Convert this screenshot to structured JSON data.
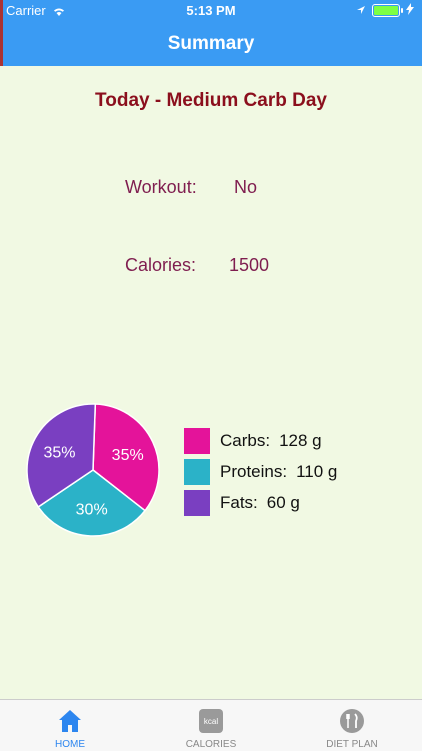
{
  "status_bar": {
    "carrier": "Carrier",
    "time": "5:13 PM"
  },
  "nav": {
    "title": "Summary"
  },
  "day_title": "Today - Medium Carb Day",
  "workout": {
    "label": "Workout:",
    "value": "No"
  },
  "calories": {
    "label": "Calories:",
    "value": "1500"
  },
  "chart_data": {
    "type": "pie",
    "slices": [
      {
        "name": "Carbs",
        "value": 35,
        "label": "35%",
        "color": "#e4139a"
      },
      {
        "name": "Proteins",
        "value": 30,
        "label": "30%",
        "color": "#2bb2c8"
      },
      {
        "name": "Fats",
        "value": 35,
        "label": "35%",
        "color": "#7a3fc1"
      }
    ]
  },
  "legend": [
    {
      "name": "Carbs:",
      "amount": "128 g",
      "color": "#e4139a"
    },
    {
      "name": "Proteins:",
      "amount": "110 g",
      "color": "#2bb2c8"
    },
    {
      "name": "Fats:",
      "amount": "60 g",
      "color": "#7a3fc1"
    }
  ],
  "tabs": [
    {
      "label": "HOME",
      "icon": "home-icon",
      "active": true
    },
    {
      "label": "CALORIES",
      "icon": "kcal-icon",
      "active": false
    },
    {
      "label": "DIET PLAN",
      "icon": "fork-knife-icon",
      "active": false
    }
  ],
  "kcal_icon_text": "kcal"
}
